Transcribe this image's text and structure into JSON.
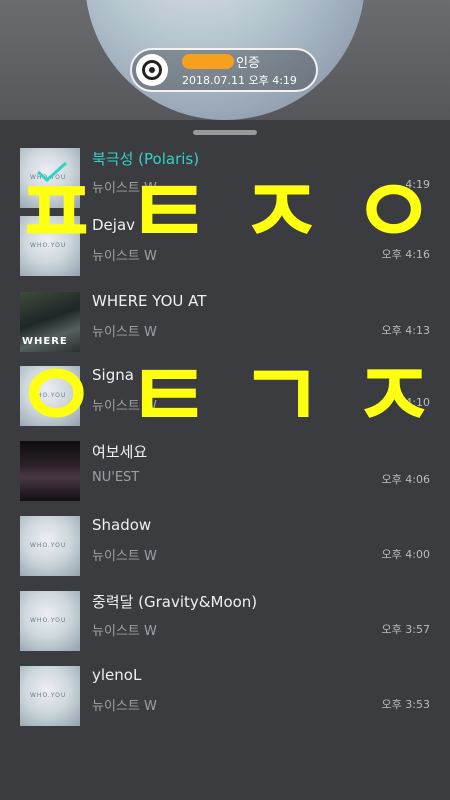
{
  "header": {
    "certificate_label": "인증",
    "certificate_date": "2018.07.11 오후 4:19"
  },
  "songs": [
    {
      "title": "북극성 (Polaris)",
      "artist": "뉴이스트 W",
      "time": "4:19",
      "active": true,
      "cover": "wbw"
    },
    {
      "title": "Dejav",
      "artist": "뉴이스트 W",
      "time": "오후 4:16",
      "cover": "wbw"
    },
    {
      "title": "WHERE YOU AT",
      "artist": "뉴이스트 W",
      "time": "오후 4:13",
      "cover": "where"
    },
    {
      "title": "Signa",
      "artist": "뉴이스트 W",
      "time": "4:10",
      "cover": "wbw"
    },
    {
      "title": "여보세요",
      "artist": "NU'EST",
      "time": "오후 4:06",
      "cover": "nuest"
    },
    {
      "title": "Shadow",
      "artist": "뉴이스트 W",
      "time": "오후 4:00",
      "cover": "wbw"
    },
    {
      "title": "중력달 (Gravity&Moon)",
      "artist": "뉴이스트 W",
      "time": "오후 3:57",
      "cover": "wbw"
    },
    {
      "title": "ylenoL",
      "artist": "뉴이스트 W",
      "time": "오후 3:53",
      "cover": "wbw"
    }
  ],
  "covers": {
    "wbw": "WHO.YOU",
    "where": "WHERE",
    "nuest": ""
  },
  "overlay_top": [
    "ㅍ",
    "ㅌ",
    "ㅈ",
    "ㅇ"
  ],
  "overlay_bottom": [
    "ㅇ",
    "ㅌ",
    "ㄱ",
    "ㅈ"
  ],
  "colors": {
    "highlight_text": "#ffff10",
    "active_title": "#33d3c3"
  }
}
